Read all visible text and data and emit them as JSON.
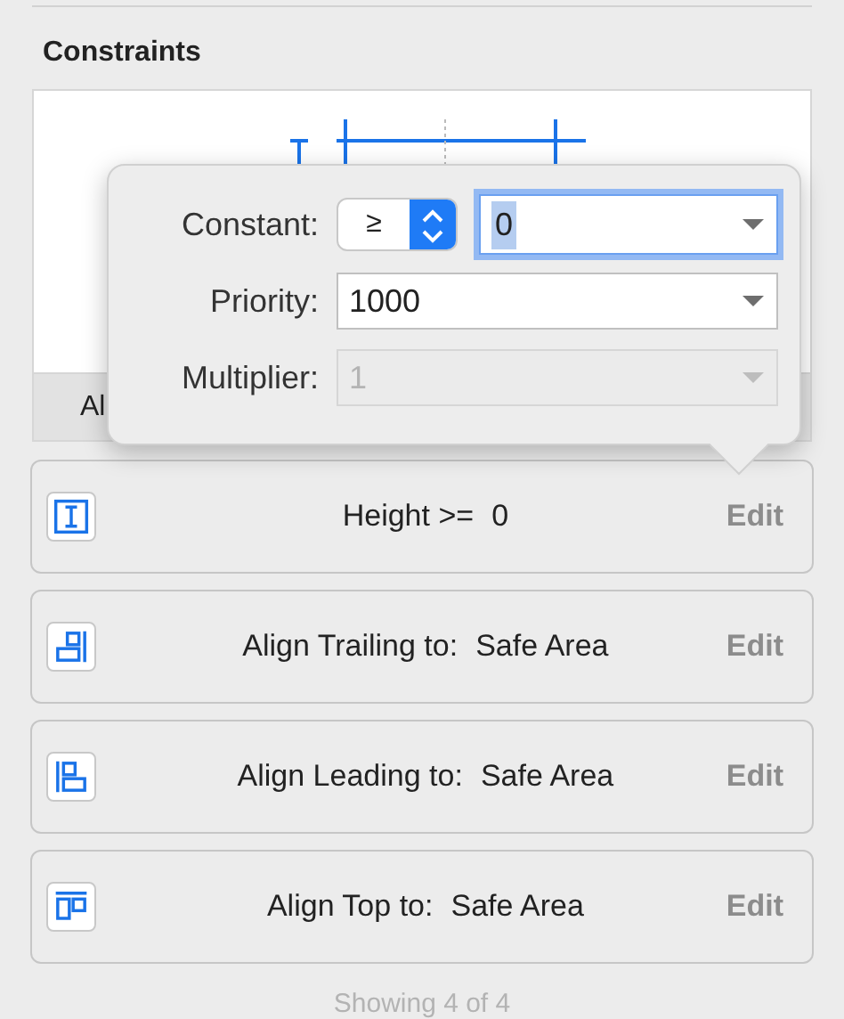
{
  "panel": {
    "title": "Constraints",
    "bar_text": "Al"
  },
  "popover": {
    "fields": [
      {
        "kind": "relation",
        "label": "Constant:",
        "relation": "≥",
        "value": "0",
        "focused": true,
        "disabled": false
      },
      {
        "kind": "combo",
        "label": "Priority:",
        "value": "1000",
        "focused": false,
        "disabled": false
      },
      {
        "kind": "combo",
        "label": "Multiplier:",
        "value": "1",
        "focused": false,
        "disabled": true
      }
    ]
  },
  "constraints": [
    {
      "kind": "height",
      "label": "Height >=",
      "value": "0",
      "action": "Edit"
    },
    {
      "kind": "trailing",
      "label": "Align Trailing to:",
      "value": "Safe Area",
      "action": "Edit"
    },
    {
      "kind": "leading",
      "label": "Align Leading to:",
      "value": "Safe Area",
      "action": "Edit"
    },
    {
      "kind": "top",
      "label": "Align Top to:",
      "value": "Safe Area",
      "action": "Edit"
    }
  ],
  "footer": "Showing 4 of 4"
}
